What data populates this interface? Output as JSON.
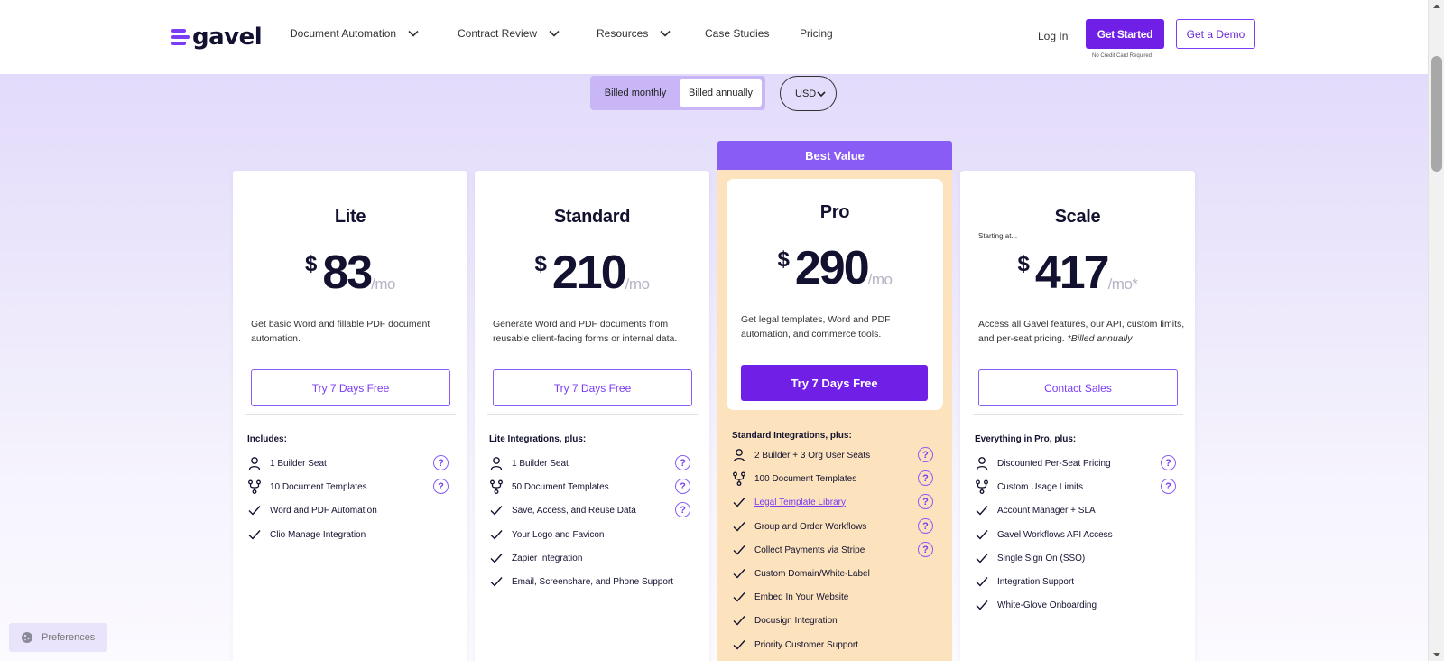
{
  "header": {
    "logo_text": "gavel",
    "nav": [
      {
        "label": "Document Automation",
        "has_dropdown": true
      },
      {
        "label": "Contract Review",
        "has_dropdown": true
      },
      {
        "label": "Resources",
        "has_dropdown": true
      },
      {
        "label": "Case Studies",
        "has_dropdown": false
      },
      {
        "label": "Pricing",
        "has_dropdown": false
      }
    ],
    "login_label": "Log In",
    "get_started_label": "Get Started",
    "no_cc_note": "No Credit Card Required",
    "demo_label": "Get a Demo"
  },
  "billing": {
    "monthly_label": "Billed monthly",
    "annually_label": "Billed annually",
    "selected": "annually",
    "currency": "USD"
  },
  "colors": {
    "brand_purple": "#7020e6",
    "best_value_bg": "#8a5cf6",
    "pro_bg": "#fde3bd"
  },
  "plans": [
    {
      "name": "Lite",
      "currency_symbol": "$",
      "price": "83",
      "per": "/mo",
      "description": "Get basic Word and fillable PDF document automation.",
      "cta": "Try 7 Days Free",
      "includes_heading": "Includes:",
      "features": [
        {
          "icon": "user-icon",
          "text": "1 Builder Seat",
          "help": true
        },
        {
          "icon": "branch-icon",
          "text": "10 Document Templates",
          "help": true
        },
        {
          "icon": "check-icon",
          "text": "Word and PDF Automation",
          "help": false
        },
        {
          "icon": "check-icon",
          "text": "Clio Manage Integration",
          "help": false
        }
      ]
    },
    {
      "name": "Standard",
      "currency_symbol": "$",
      "price": "210",
      "per": "/mo",
      "description": "Generate Word and PDF documents from reusable client-facing forms or internal data.",
      "cta": "Try 7 Days Free",
      "includes_heading": "Lite Integrations, plus:",
      "features": [
        {
          "icon": "user-icon",
          "text": "1 Builder Seat",
          "help": true
        },
        {
          "icon": "branch-icon",
          "text": "50 Document Templates",
          "help": true
        },
        {
          "icon": "check-icon",
          "text": "Save, Access, and Reuse Data",
          "help": true
        },
        {
          "icon": "check-icon",
          "text": "Your Logo and Favicon",
          "help": false
        },
        {
          "icon": "check-icon",
          "text": "Zapier Integration",
          "help": false
        },
        {
          "icon": "check-icon",
          "text": "Email, Screenshare, and Phone Support",
          "help": false
        }
      ]
    },
    {
      "name": "Pro",
      "badge": "Best Value",
      "currency_symbol": "$",
      "price": "290",
      "per": "/mo",
      "description": "Get legal templates, Word and PDF automation, and commerce tools.",
      "cta": "Try 7 Days Free",
      "includes_heading": "Standard Integrations, plus:",
      "features": [
        {
          "icon": "user-icon",
          "text": "2 Builder + 3 Org User Seats",
          "help": true
        },
        {
          "icon": "branch-icon",
          "text": "100 Document Templates",
          "help": true
        },
        {
          "icon": "check-icon",
          "text": "Legal Template Library",
          "help": true,
          "link": true
        },
        {
          "icon": "check-icon",
          "text": "Group and Order Workflows",
          "help": true
        },
        {
          "icon": "check-icon",
          "text": "Collect Payments via Stripe",
          "help": true
        },
        {
          "icon": "check-icon",
          "text": "Custom Domain/White-Label",
          "help": false
        },
        {
          "icon": "check-icon",
          "text": "Embed In Your Website",
          "help": false
        },
        {
          "icon": "check-icon",
          "text": "Docusign Integration",
          "help": false
        },
        {
          "icon": "check-icon",
          "text": "Priority Customer Support",
          "help": false
        }
      ]
    },
    {
      "name": "Scale",
      "starting_at": "Starting at...",
      "currency_symbol": "$",
      "price": "417",
      "per": "/mo*",
      "description": "Access all Gavel features, our API, custom limits, and per-seat pricing.",
      "description_note": "*Billed annually",
      "cta": "Contact Sales",
      "includes_heading": "Everything in Pro, plus:",
      "features": [
        {
          "icon": "user-icon",
          "text": "Discounted Per-Seat Pricing",
          "help": true
        },
        {
          "icon": "branch-icon",
          "text": "Custom Usage Limits",
          "help": true
        },
        {
          "icon": "check-icon",
          "text": "Account Manager + SLA",
          "help": false
        },
        {
          "icon": "check-icon",
          "text": "Gavel Workflows API Access",
          "help": false
        },
        {
          "icon": "check-icon",
          "text": "Single Sign On (SSO)",
          "help": false
        },
        {
          "icon": "check-icon",
          "text": "Integration Support",
          "help": false
        },
        {
          "icon": "check-icon",
          "text": "White-Glove Onboarding",
          "help": false
        }
      ]
    }
  ],
  "help_glyph": "?",
  "preferences_label": "Preferences"
}
